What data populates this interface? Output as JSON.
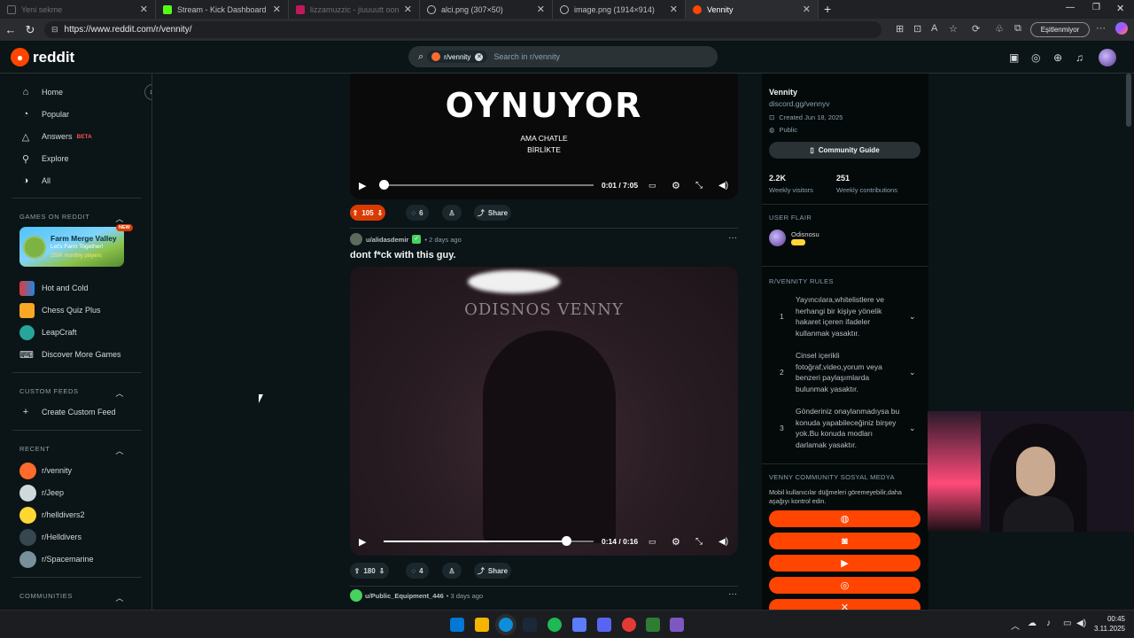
{
  "browser": {
    "tabs": [
      {
        "title": "Yeni sekme",
        "state": "dim"
      },
      {
        "title": "Stream - Kick Dashboard",
        "state": "normal"
      },
      {
        "title": "lizzamuzzic - jiuuuutt oonnee (sk...",
        "state": "dim"
      },
      {
        "title": "alci.png (307×50)",
        "state": "normal"
      },
      {
        "title": "image.png (1914×914)",
        "state": "normal"
      },
      {
        "title": "Vennity",
        "state": "active"
      }
    ],
    "url": "https://www.reddit.com/r/vennity/",
    "sync_label": "Eşitlenmiyor"
  },
  "header": {
    "logo_text": "reddit",
    "search_chip": "r/vennity",
    "search_placeholder": "Search in r/vennity"
  },
  "sidebar": {
    "main_items": [
      {
        "label": "Home",
        "icon": "home-icon"
      },
      {
        "label": "Popular",
        "icon": "popular-icon"
      },
      {
        "label": "Answers",
        "icon": "answers-icon",
        "badge": "BETA"
      },
      {
        "label": "Explore",
        "icon": "explore-icon"
      },
      {
        "label": "All",
        "icon": "all-icon"
      }
    ],
    "games_title": "GAMES ON REDDIT",
    "featured_game": {
      "title": "Farm Merge Valley",
      "subtitle": "Let's Farm Together!",
      "stat": "255K monthly players",
      "badge": "NEW"
    },
    "games": [
      "Hot and Cold",
      "Chess Quiz Plus",
      "LeapCraft",
      "Discover More Games"
    ],
    "custom_feeds_title": "CUSTOM FEEDS",
    "create_custom_feed": "Create Custom Feed",
    "recent_title": "RECENT",
    "recent": [
      "r/vennity",
      "r/Jeep",
      "r/helldivers2",
      "r/Helldivers",
      "r/Spacemarine"
    ],
    "communities_title": "COMMUNITIES"
  },
  "posts": [
    {
      "video_overlay_big": "OYNUYOR",
      "video_overlay_small": [
        "AMA CHATLE",
        "BİRLİKTE"
      ],
      "time": "0:01 / 7:05",
      "progress": 0.002,
      "votes": "105",
      "comments": "6",
      "share": "Share"
    },
    {
      "author": "u/alidasdemir",
      "age": "• 2 days ago",
      "title": "dont f*ck with this guy.",
      "video_overlay": "ODISNOS VENNY",
      "time": "0:14 / 0:16",
      "progress": 0.87,
      "votes": "180",
      "comments": "4",
      "share": "Share"
    },
    {
      "author": "u/Public_Equipment_446",
      "age": "• 3 days ago"
    }
  ],
  "community": {
    "name": "Vennity",
    "link": "discord.gg/vennyv",
    "created": "Created Jun 18, 2025",
    "visibility": "Public",
    "guide_button": "Community Guide",
    "visitors": "2.2K",
    "visitors_label": "Weekly visitors",
    "contributions": "251",
    "contributions_label": "Weekly contributions",
    "flair_title": "USER FLAIR",
    "flair_user": "Odisnosu",
    "rules_title": "R/VENNITY RULES",
    "rules": [
      {
        "n": "1",
        "text": "Yayıncılara,whitelistlere ve herhangi bir kişiye yönelik hakaret içeren ifadeler kullanmak yasaktır."
      },
      {
        "n": "2",
        "text": "Cinsel içerikli fotoğraf,video,yorum veya benzeri paylaşımlarda bulunmak yasaktır."
      },
      {
        "n": "3",
        "text": "Gönderiniz onaylanmadıysa bu konuda yapabileceğiniz birşey yok.Bu konuda modları darlamak yasaktır."
      }
    ],
    "social_title": "VENNY COMMUNITY SOSYAL MEDYA",
    "social_note": "Mobil kullanıcılar düğmeleri göremeyebilir,daha aşağıyı kontrol edin.",
    "social_buttons": [
      "web-icon",
      "discord-icon",
      "youtube-icon",
      "instagram-icon",
      "x-icon"
    ]
  },
  "taskbar": {
    "time": "00:45",
    "date": "3.11.2025"
  },
  "colors": {
    "accent": "#ff4500",
    "bg": "#0b1416",
    "upvote_active": "#d93a00"
  }
}
